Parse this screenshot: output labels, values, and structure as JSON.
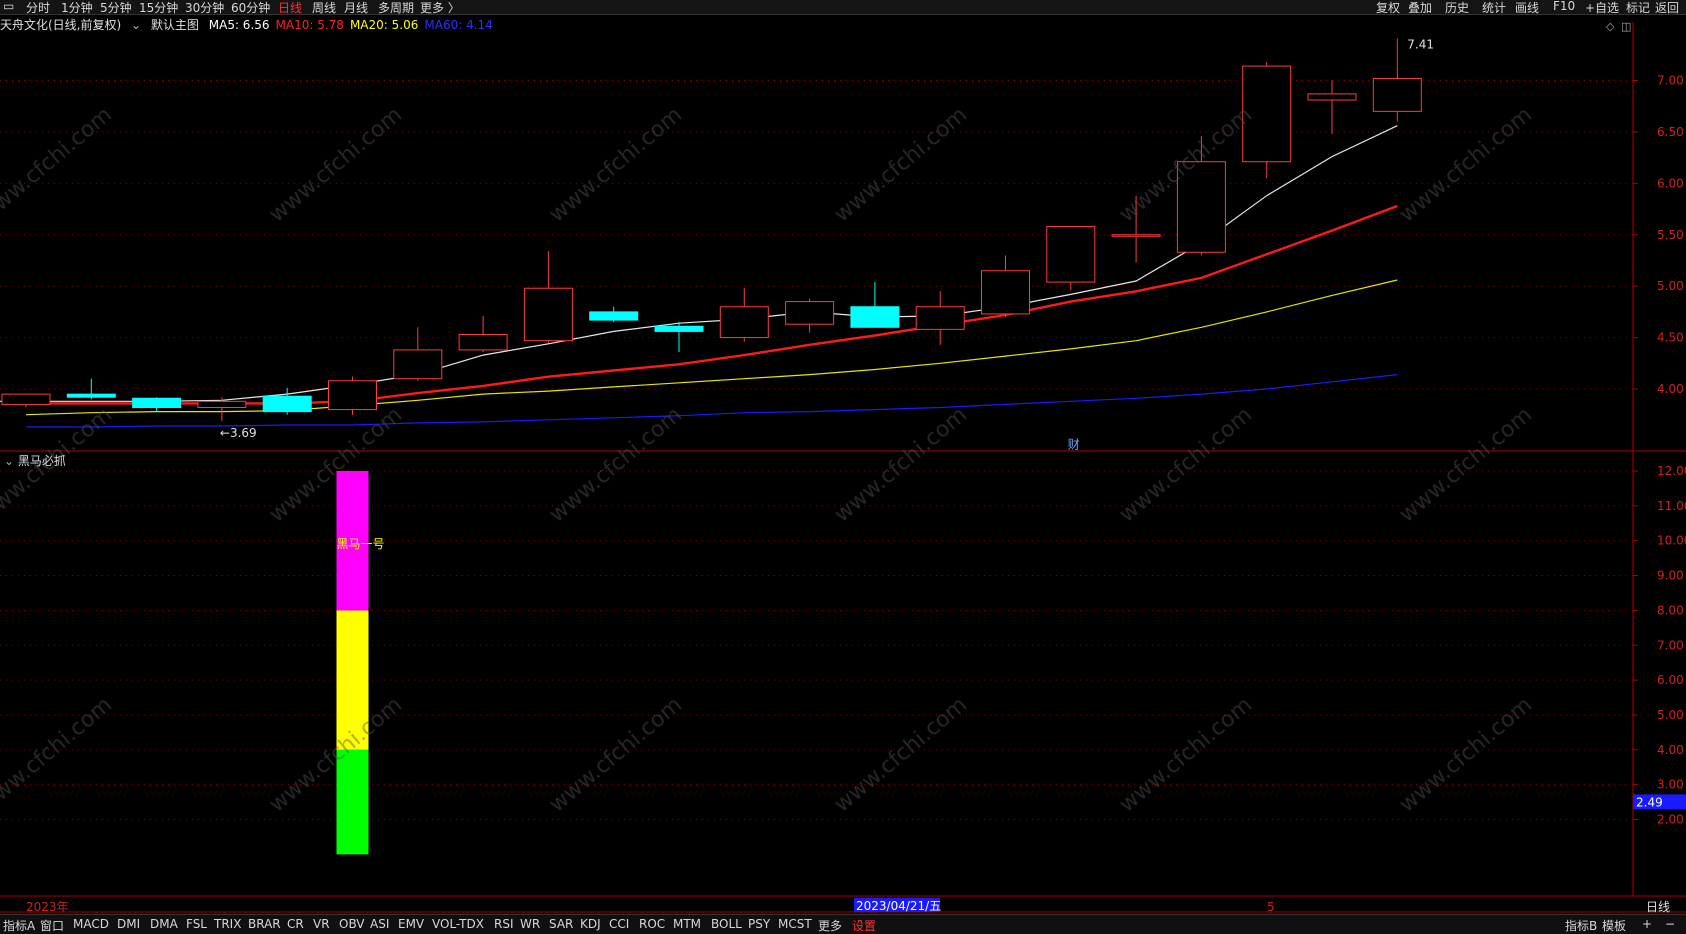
{
  "toolbar": {
    "periods": [
      "分时",
      "1分钟",
      "5分钟",
      "15分钟",
      "30分钟",
      "60分钟",
      "日线",
      "周线",
      "月线",
      "多周期",
      "更多 〉"
    ],
    "active_period": "日线",
    "right": [
      "复权",
      "叠加",
      "历史",
      "统计",
      "画线",
      "F10",
      "+自选",
      "标记",
      "返回"
    ]
  },
  "info": {
    "stock": "天舟文化(日线,前复权)",
    "main_label": "默认主图",
    "ma": [
      {
        "label": "MA5: 6.56",
        "color": "#ffffff"
      },
      {
        "label": "MA10: 5.78",
        "color": "#ff2020"
      },
      {
        "label": "MA20: 5.06",
        "color": "#ffff00"
      },
      {
        "label": "MA60: 4.14",
        "color": "#3030ff"
      }
    ]
  },
  "indicator_title": "黑马必抓",
  "bottom": {
    "items": [
      "指标A",
      "窗口",
      "MACD",
      "DMI",
      "DMA",
      "FSL",
      "TRIX",
      "BRAR",
      "CR",
      "VR",
      "OBV",
      "ASI",
      "EMV",
      "VOL-TDX",
      "RSI",
      "WR",
      "SAR",
      "KDJ",
      "CCI",
      "ROC",
      "MTM",
      "BOLL",
      "PSY",
      "MCST",
      "更多",
      "设置"
    ],
    "active_item": "设置",
    "right": [
      "指标B",
      "模板",
      "+",
      "−"
    ]
  },
  "colors": {
    "up": "#ff3b3b",
    "down": "#00ffff",
    "grid": "#8b0000",
    "axis": "#b00000",
    "magenta": "#ff00ff",
    "yellow": "#ffff00",
    "green": "#00ff00"
  },
  "chart_data": [
    {
      "type": "candlestick",
      "title": "",
      "ylim": [
        3.5,
        7.5
      ],
      "yticks": [
        "7.00",
        "6.50",
        "6.00",
        "5.50",
        "5.00",
        "4.50",
        "4.00"
      ],
      "candles": [
        {
          "o": 3.85,
          "h": 3.95,
          "l": 3.82,
          "c": 3.95
        },
        {
          "o": 3.95,
          "h": 4.1,
          "l": 3.9,
          "c": 3.92
        },
        {
          "o": 3.91,
          "h": 3.92,
          "l": 3.78,
          "c": 3.82
        },
        {
          "o": 3.82,
          "h": 3.92,
          "l": 3.69,
          "c": 3.88
        },
        {
          "o": 3.93,
          "h": 4.01,
          "l": 3.75,
          "c": 3.78
        },
        {
          "o": 3.8,
          "h": 4.12,
          "l": 3.75,
          "c": 4.08
        },
        {
          "o": 4.1,
          "h": 4.6,
          "l": 4.08,
          "c": 4.38
        },
        {
          "o": 4.38,
          "h": 4.71,
          "l": 4.36,
          "c": 4.53
        },
        {
          "o": 4.47,
          "h": 5.34,
          "l": 4.45,
          "c": 4.98
        },
        {
          "o": 4.75,
          "h": 4.8,
          "l": 4.65,
          "c": 4.67
        },
        {
          "o": 4.61,
          "h": 4.65,
          "l": 4.36,
          "c": 4.56
        },
        {
          "o": 4.5,
          "h": 4.98,
          "l": 4.46,
          "c": 4.8
        },
        {
          "o": 4.63,
          "h": 4.88,
          "l": 4.55,
          "c": 4.85
        },
        {
          "o": 4.8,
          "h": 5.04,
          "l": 4.6,
          "c": 4.6
        },
        {
          "o": 4.58,
          "h": 4.95,
          "l": 4.43,
          "c": 4.8
        },
        {
          "o": 4.73,
          "h": 5.3,
          "l": 4.7,
          "c": 5.15
        },
        {
          "o": 5.04,
          "h": 5.58,
          "l": 4.96,
          "c": 5.58
        },
        {
          "o": 5.5,
          "h": 5.88,
          "l": 5.23,
          "c": 5.5
        },
        {
          "o": 5.33,
          "h": 6.46,
          "l": 5.3,
          "c": 6.21
        },
        {
          "o": 6.21,
          "h": 7.18,
          "l": 6.05,
          "c": 7.14
        },
        {
          "o": 6.81,
          "h": 7.0,
          "l": 6.48,
          "c": 6.87
        },
        {
          "o": 6.7,
          "h": 7.41,
          "l": 6.6,
          "c": 7.02
        }
      ],
      "ma5": [
        3.88,
        3.88,
        3.88,
        3.88,
        3.89,
        3.95,
        4.04,
        4.14,
        4.33,
        4.44,
        4.56,
        4.64,
        4.68,
        4.75,
        4.7,
        4.71,
        4.8,
        4.92,
        5.05,
        5.42,
        5.88,
        6.26,
        6.56
      ],
      "ma10": [
        3.86,
        3.86,
        3.86,
        3.86,
        3.86,
        3.88,
        3.96,
        4.03,
        4.12,
        4.18,
        4.24,
        4.33,
        4.43,
        4.52,
        4.62,
        4.72,
        4.85,
        4.95,
        5.08,
        5.31,
        5.54,
        5.78
      ],
      "ma20": [
        3.75,
        3.77,
        3.78,
        3.78,
        3.79,
        3.84,
        3.89,
        3.95,
        3.98,
        4.02,
        4.06,
        4.1,
        4.14,
        4.19,
        4.25,
        4.32,
        4.39,
        4.47,
        4.6,
        4.75,
        4.91,
        5.06
      ],
      "ma60": [
        3.63,
        3.63,
        3.64,
        3.64,
        3.65,
        3.65,
        3.67,
        3.68,
        3.7,
        3.72,
        3.74,
        3.77,
        3.78,
        3.8,
        3.82,
        3.85,
        3.88,
        3.91,
        3.95,
        4.0,
        4.07,
        4.14
      ],
      "annotations": [
        {
          "text": "7.41",
          "index": 21,
          "value": 7.41
        },
        {
          "text": "←3.69",
          "index": 3,
          "value": 3.69
        },
        {
          "text": "财",
          "index": 16,
          "value": 3.5
        }
      ]
    },
    {
      "type": "bar",
      "title": "黑马必抓",
      "ylim": [
        1.0,
        12.5
      ],
      "yticks": [
        "12.00",
        "11.00",
        "10.00",
        "9.00",
        "8.00",
        "7.00",
        "6.00",
        "5.00",
        "4.00",
        "3.00",
        "2.00"
      ],
      "current_value": "2.49",
      "label": "黑马一号",
      "bar_index": 5,
      "segments": [
        {
          "from": 1.0,
          "to": 4.0,
          "color": "#00ff00"
        },
        {
          "from": 4.0,
          "to": 8.0,
          "color": "#ffff00"
        },
        {
          "from": 8.0,
          "to": 12.0,
          "color": "#ff00ff"
        }
      ]
    }
  ],
  "dates": {
    "left": "2023年",
    "cursor": "2023/04/21/五",
    "mid_label": "5",
    "period": "日线"
  }
}
